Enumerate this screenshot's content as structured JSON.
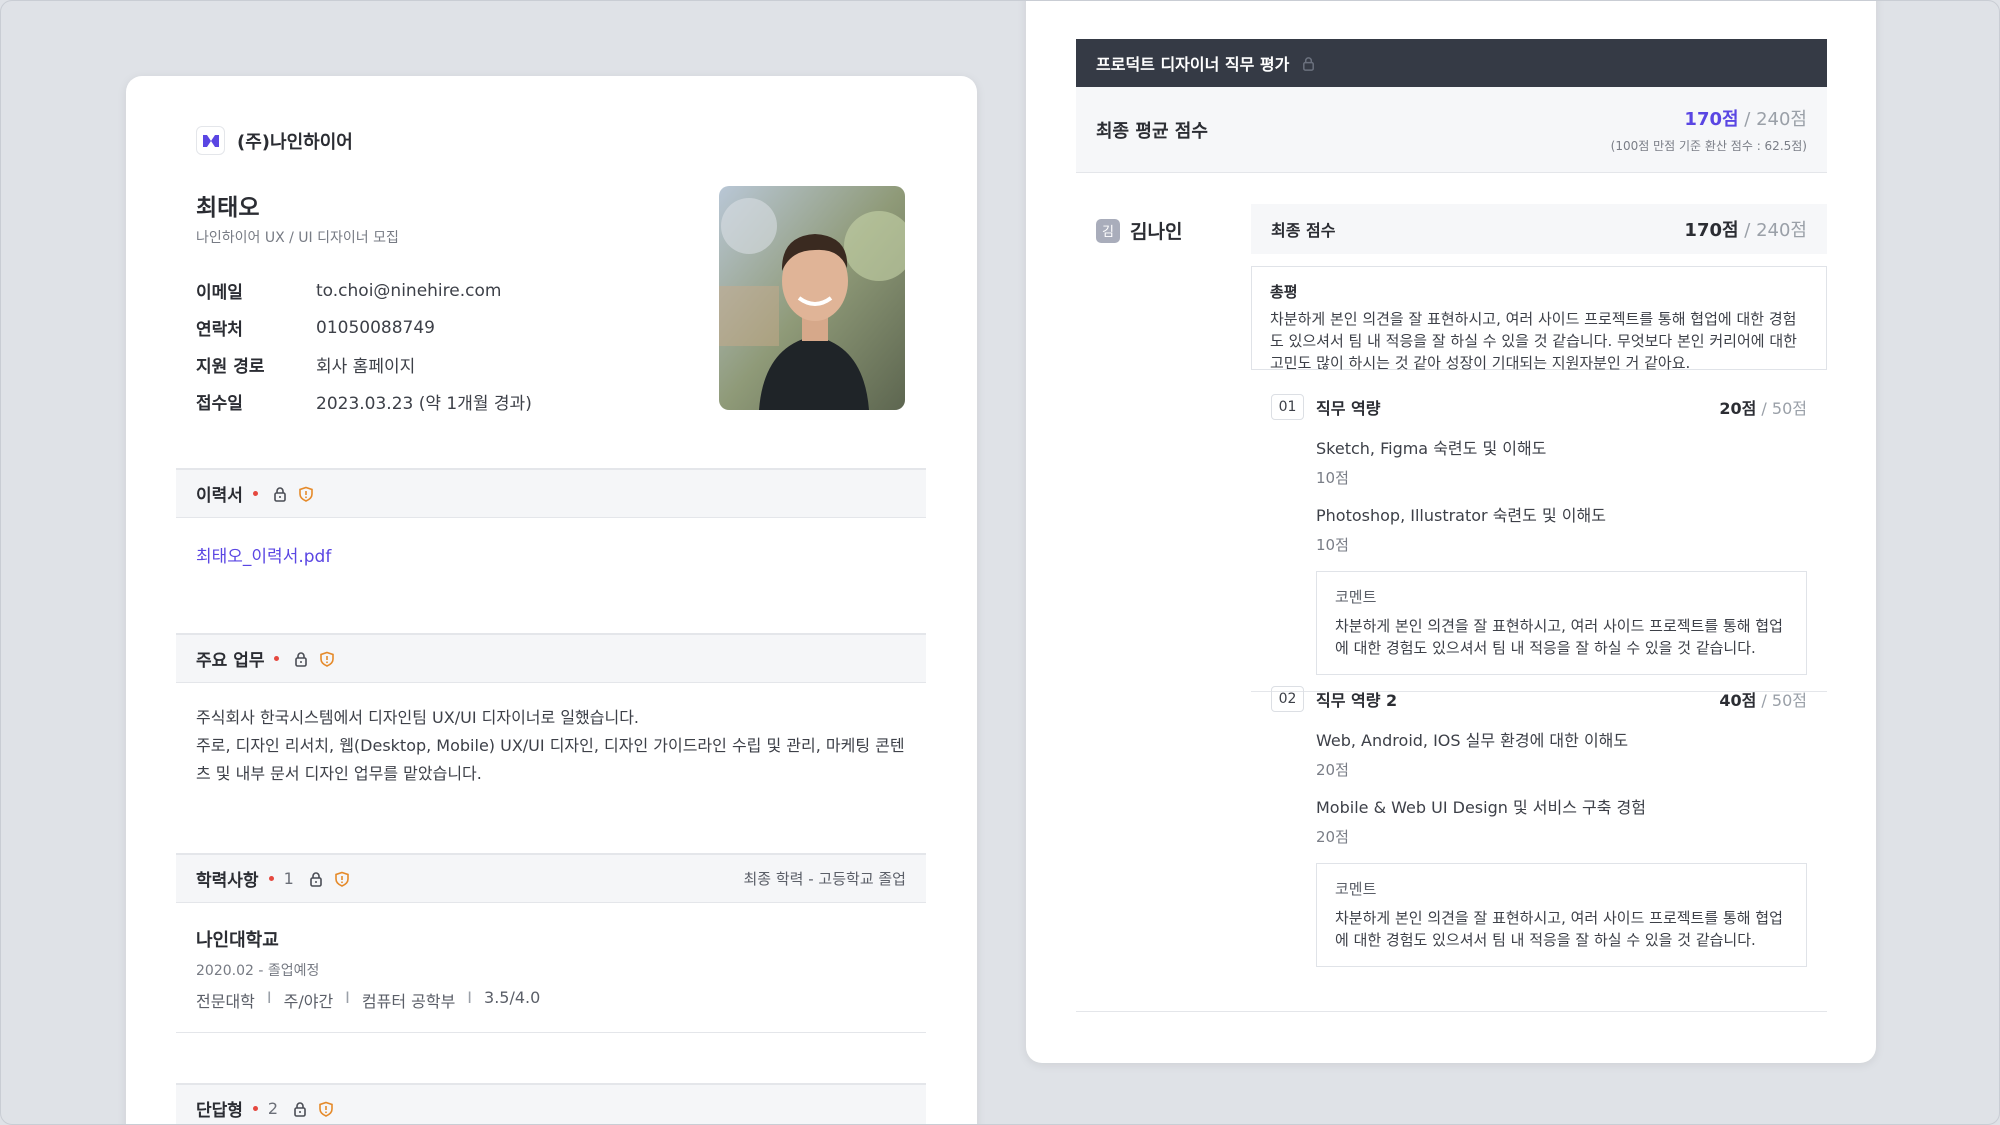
{
  "left": {
    "company_name": "(주)나인하이어",
    "applicant_name": "최태오",
    "job_title": "나인하이어 UX / UI 디자이너 모집",
    "info": [
      {
        "label": "이메일",
        "value": "to.choi@ninehire.com"
      },
      {
        "label": "연락처",
        "value": "01050088749"
      },
      {
        "label": "지원 경로",
        "value": "회사 홈페이지"
      },
      {
        "label": "접수일",
        "value": "2023.03.23 (약 1개월 경과)"
      }
    ],
    "resume": {
      "title": "이력서",
      "file": "최태오_이력서.pdf"
    },
    "duties": {
      "title": "주요 업무",
      "lines": [
        "주식회사 한국시스템에서 디자인팀 UX/UI 디자이너로 일했습니다.",
        "주로, 디자인 리서치, 웹(Desktop, Mobile) UX/UI 디자인, 디자인 가이드라인 수립 및 관리, 마케팅 콘텐",
        "츠 및 내부 문서 디자인 업무를 맡았습니다."
      ]
    },
    "education": {
      "title": "학력사항",
      "count": "1",
      "summary": "최종 학력 - 고등학교 졸업",
      "school": "나인대학교",
      "period": "2020.02 - 졸업예정",
      "details": [
        "전문대학",
        "주/야간",
        "컴퓨터 공학부",
        "3.5/4.0"
      ],
      "separator": "I"
    },
    "short_answer": {
      "title": "단답형",
      "count": "2"
    }
  },
  "right": {
    "header": "프로덕트 디자이너 직무 평가",
    "avg_label": "최종 평균 점수",
    "avg_score": "170점",
    "avg_total": " / 240점",
    "avg_note": "(100점 만점 기준 환산 점수 : 62.5점)",
    "evaluator_initial": "김",
    "evaluator_name": "김나인",
    "final_label": "최종 점수",
    "final_score": "170점",
    "final_total": " / 240점",
    "review_title": "총평",
    "review_lines": [
      "차분하게 본인 의견을 잘 표현하시고, 여러 사이드 프로젝트를 통해 협업에 대한 경험",
      "도 있으셔서 팀 내 적응을 잘 하실 수 있을 것 같습니다. 무엇보다 본인 커리어에 대한",
      "고민도 많이 하시는 것 같아 성장이 기대되는 지원자분인 거 같아요."
    ],
    "criteria": [
      {
        "num": "01",
        "title": "직무 역량",
        "score": "20점",
        "total": " / 50점",
        "items": [
          {
            "label": "Sketch, Figma 숙련도 및 이해도",
            "pts": "10점"
          },
          {
            "label": "Photoshop, Illustrator 숙련도 및 이해도",
            "pts": "10점"
          }
        ],
        "comment_title": "코멘트",
        "comment_lines": [
          "차분하게 본인 의견을 잘 표현하시고, 여러 사이드 프로젝트를 통해 협업",
          "에 대한 경험도 있으셔서 팀 내 적응을 잘 하실 수 있을 것 같습니다."
        ]
      },
      {
        "num": "02",
        "title": "직무 역량 2",
        "score": "40점",
        "total": " / 50점",
        "items": [
          {
            "label": "Web, Android, IOS 실무 환경에 대한 이해도",
            "pts": "20점"
          },
          {
            "label": "Mobile & Web UI Design 및 서비스 구축 경험",
            "pts": "20점"
          }
        ],
        "comment_title": "코멘트",
        "comment_lines": [
          "차분하게 본인 의견을 잘 표현하시고, 여러 사이드 프로젝트를 통해 협업",
          "에 대한 경험도 있으셔서 팀 내 적응을 잘 하실 수 있을 것 같습니다."
        ]
      }
    ]
  },
  "colors": {
    "accent": "#5a46e3",
    "header_dark": "#353a45",
    "required_dot": "#e5483f",
    "shield_orange": "#e58a2a",
    "background": "#dfe2e7"
  },
  "icons": [
    "ninehire-logo-icon",
    "lock-icon",
    "shield-icon"
  ]
}
